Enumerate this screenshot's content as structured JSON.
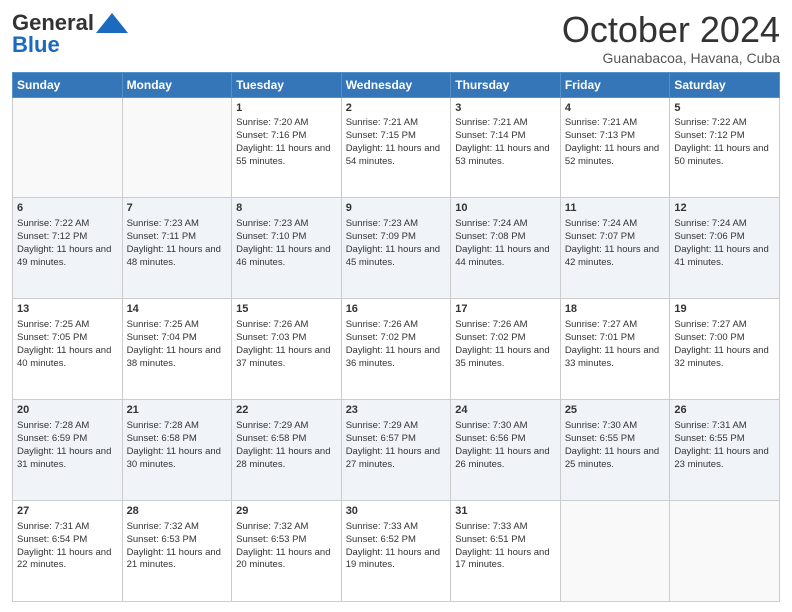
{
  "header": {
    "logo_general": "General",
    "logo_blue": "Blue",
    "month_title": "October 2024",
    "location": "Guanabacoa, Havana, Cuba"
  },
  "days_of_week": [
    "Sunday",
    "Monday",
    "Tuesday",
    "Wednesday",
    "Thursday",
    "Friday",
    "Saturday"
  ],
  "weeks": [
    [
      {
        "day": "",
        "sunrise": "",
        "sunset": "",
        "daylight": ""
      },
      {
        "day": "",
        "sunrise": "",
        "sunset": "",
        "daylight": ""
      },
      {
        "day": "1",
        "sunrise": "Sunrise: 7:20 AM",
        "sunset": "Sunset: 7:16 PM",
        "daylight": "Daylight: 11 hours and 55 minutes."
      },
      {
        "day": "2",
        "sunrise": "Sunrise: 7:21 AM",
        "sunset": "Sunset: 7:15 PM",
        "daylight": "Daylight: 11 hours and 54 minutes."
      },
      {
        "day": "3",
        "sunrise": "Sunrise: 7:21 AM",
        "sunset": "Sunset: 7:14 PM",
        "daylight": "Daylight: 11 hours and 53 minutes."
      },
      {
        "day": "4",
        "sunrise": "Sunrise: 7:21 AM",
        "sunset": "Sunset: 7:13 PM",
        "daylight": "Daylight: 11 hours and 52 minutes."
      },
      {
        "day": "5",
        "sunrise": "Sunrise: 7:22 AM",
        "sunset": "Sunset: 7:12 PM",
        "daylight": "Daylight: 11 hours and 50 minutes."
      }
    ],
    [
      {
        "day": "6",
        "sunrise": "Sunrise: 7:22 AM",
        "sunset": "Sunset: 7:12 PM",
        "daylight": "Daylight: 11 hours and 49 minutes."
      },
      {
        "day": "7",
        "sunrise": "Sunrise: 7:23 AM",
        "sunset": "Sunset: 7:11 PM",
        "daylight": "Daylight: 11 hours and 48 minutes."
      },
      {
        "day": "8",
        "sunrise": "Sunrise: 7:23 AM",
        "sunset": "Sunset: 7:10 PM",
        "daylight": "Daylight: 11 hours and 46 minutes."
      },
      {
        "day": "9",
        "sunrise": "Sunrise: 7:23 AM",
        "sunset": "Sunset: 7:09 PM",
        "daylight": "Daylight: 11 hours and 45 minutes."
      },
      {
        "day": "10",
        "sunrise": "Sunrise: 7:24 AM",
        "sunset": "Sunset: 7:08 PM",
        "daylight": "Daylight: 11 hours and 44 minutes."
      },
      {
        "day": "11",
        "sunrise": "Sunrise: 7:24 AM",
        "sunset": "Sunset: 7:07 PM",
        "daylight": "Daylight: 11 hours and 42 minutes."
      },
      {
        "day": "12",
        "sunrise": "Sunrise: 7:24 AM",
        "sunset": "Sunset: 7:06 PM",
        "daylight": "Daylight: 11 hours and 41 minutes."
      }
    ],
    [
      {
        "day": "13",
        "sunrise": "Sunrise: 7:25 AM",
        "sunset": "Sunset: 7:05 PM",
        "daylight": "Daylight: 11 hours and 40 minutes."
      },
      {
        "day": "14",
        "sunrise": "Sunrise: 7:25 AM",
        "sunset": "Sunset: 7:04 PM",
        "daylight": "Daylight: 11 hours and 38 minutes."
      },
      {
        "day": "15",
        "sunrise": "Sunrise: 7:26 AM",
        "sunset": "Sunset: 7:03 PM",
        "daylight": "Daylight: 11 hours and 37 minutes."
      },
      {
        "day": "16",
        "sunrise": "Sunrise: 7:26 AM",
        "sunset": "Sunset: 7:02 PM",
        "daylight": "Daylight: 11 hours and 36 minutes."
      },
      {
        "day": "17",
        "sunrise": "Sunrise: 7:26 AM",
        "sunset": "Sunset: 7:02 PM",
        "daylight": "Daylight: 11 hours and 35 minutes."
      },
      {
        "day": "18",
        "sunrise": "Sunrise: 7:27 AM",
        "sunset": "Sunset: 7:01 PM",
        "daylight": "Daylight: 11 hours and 33 minutes."
      },
      {
        "day": "19",
        "sunrise": "Sunrise: 7:27 AM",
        "sunset": "Sunset: 7:00 PM",
        "daylight": "Daylight: 11 hours and 32 minutes."
      }
    ],
    [
      {
        "day": "20",
        "sunrise": "Sunrise: 7:28 AM",
        "sunset": "Sunset: 6:59 PM",
        "daylight": "Daylight: 11 hours and 31 minutes."
      },
      {
        "day": "21",
        "sunrise": "Sunrise: 7:28 AM",
        "sunset": "Sunset: 6:58 PM",
        "daylight": "Daylight: 11 hours and 30 minutes."
      },
      {
        "day": "22",
        "sunrise": "Sunrise: 7:29 AM",
        "sunset": "Sunset: 6:58 PM",
        "daylight": "Daylight: 11 hours and 28 minutes."
      },
      {
        "day": "23",
        "sunrise": "Sunrise: 7:29 AM",
        "sunset": "Sunset: 6:57 PM",
        "daylight": "Daylight: 11 hours and 27 minutes."
      },
      {
        "day": "24",
        "sunrise": "Sunrise: 7:30 AM",
        "sunset": "Sunset: 6:56 PM",
        "daylight": "Daylight: 11 hours and 26 minutes."
      },
      {
        "day": "25",
        "sunrise": "Sunrise: 7:30 AM",
        "sunset": "Sunset: 6:55 PM",
        "daylight": "Daylight: 11 hours and 25 minutes."
      },
      {
        "day": "26",
        "sunrise": "Sunrise: 7:31 AM",
        "sunset": "Sunset: 6:55 PM",
        "daylight": "Daylight: 11 hours and 23 minutes."
      }
    ],
    [
      {
        "day": "27",
        "sunrise": "Sunrise: 7:31 AM",
        "sunset": "Sunset: 6:54 PM",
        "daylight": "Daylight: 11 hours and 22 minutes."
      },
      {
        "day": "28",
        "sunrise": "Sunrise: 7:32 AM",
        "sunset": "Sunset: 6:53 PM",
        "daylight": "Daylight: 11 hours and 21 minutes."
      },
      {
        "day": "29",
        "sunrise": "Sunrise: 7:32 AM",
        "sunset": "Sunset: 6:53 PM",
        "daylight": "Daylight: 11 hours and 20 minutes."
      },
      {
        "day": "30",
        "sunrise": "Sunrise: 7:33 AM",
        "sunset": "Sunset: 6:52 PM",
        "daylight": "Daylight: 11 hours and 19 minutes."
      },
      {
        "day": "31",
        "sunrise": "Sunrise: 7:33 AM",
        "sunset": "Sunset: 6:51 PM",
        "daylight": "Daylight: 11 hours and 17 minutes."
      },
      {
        "day": "",
        "sunrise": "",
        "sunset": "",
        "daylight": ""
      },
      {
        "day": "",
        "sunrise": "",
        "sunset": "",
        "daylight": ""
      }
    ]
  ]
}
